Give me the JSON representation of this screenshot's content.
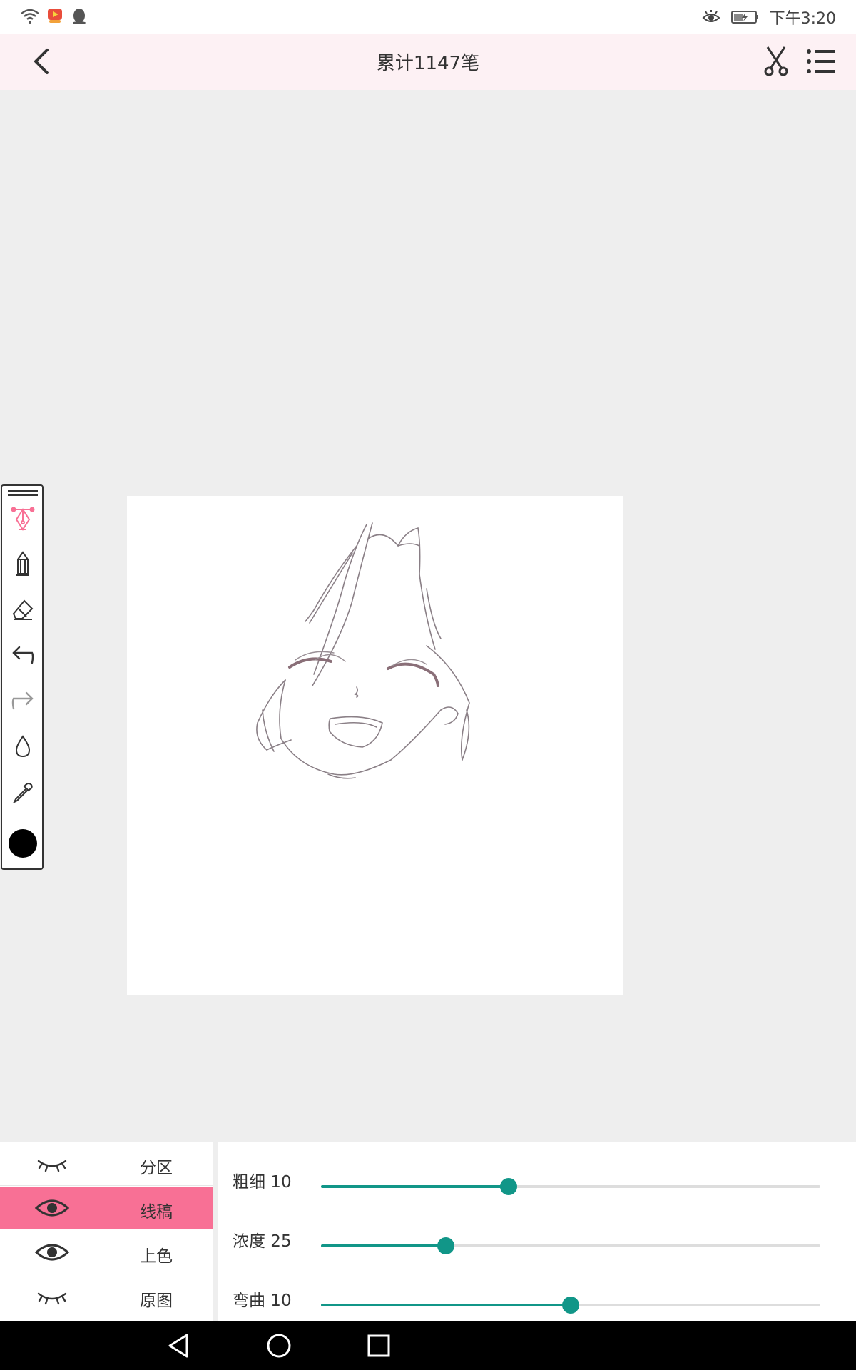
{
  "status_bar": {
    "time": "下午3:20"
  },
  "app_bar": {
    "title": "累计1147笔",
    "icons": [
      "back-arrow-icon",
      "scissors-icon",
      "menu-list-icon"
    ]
  },
  "tools": [
    "pen-nib-icon",
    "pencil-icon",
    "eraser-icon",
    "undo-icon",
    "redo-icon",
    "drop-icon",
    "eyedropper-icon"
  ],
  "accent_colors": {
    "pink": "#f87095",
    "teal": "#119688",
    "current_color": "#000000"
  },
  "layers": [
    {
      "label": "分区",
      "visible": false,
      "active": false
    },
    {
      "label": "线稿",
      "visible": true,
      "active": true
    },
    {
      "label": "上色",
      "visible": true,
      "active": false
    },
    {
      "label": "原图",
      "visible": false,
      "active": false
    }
  ],
  "sliders": [
    {
      "label": "粗细 10",
      "fraction": 0.375
    },
    {
      "label": "浓度 25",
      "fraction": 0.25
    },
    {
      "label": "弯曲 10",
      "fraction": 0.5
    }
  ]
}
